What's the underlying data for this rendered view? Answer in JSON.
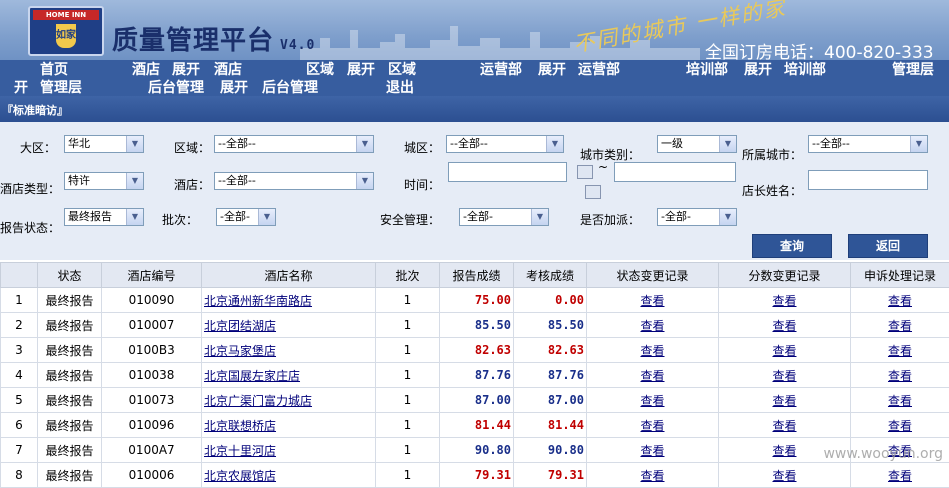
{
  "header": {
    "logo_brand": "HOME INN",
    "logo_glyph": "如家",
    "title": "质量管理平台",
    "version": "V4.0",
    "slogan": "不同的城市 一样的家",
    "phone": "全国订房电话：400-820-333"
  },
  "nav": {
    "row1": [
      "首页",
      "酒店",
      "展开",
      "酒店",
      "区域",
      "展开",
      "区域",
      "运营部",
      "展开",
      "运营部",
      "培训部",
      "展开",
      "培训部",
      "管理层"
    ],
    "row2": [
      "开",
      "管理层",
      "后台管理",
      "展开",
      "后台管理",
      "退出"
    ]
  },
  "subbar": {
    "label": "『标准暗访』"
  },
  "filters": {
    "region_label": "大区：",
    "region_value": "华北",
    "area_label": "区域：",
    "area_value": "--全部--",
    "district_label": "城区：",
    "district_value": "--全部--",
    "city_type_label": "城市类别：",
    "city_type_value": "一级",
    "city_label": "所属城市：",
    "city_value": "--全部--",
    "hotel_type_label": "酒店类型：",
    "hotel_type_value": "特许",
    "hotel_label": "酒店：",
    "hotel_value": "--全部--",
    "time_label": "时间：",
    "time_sep": "~",
    "manager_label": "店长姓名：",
    "report_status_label": "报告状态：",
    "report_status_value": "最终报告",
    "batch_label": "批次：",
    "batch_value": "-全部-",
    "safety_label": "安全管理：",
    "safety_value": "-全部-",
    "dispatch_label": "是否加派：",
    "dispatch_value": "-全部-",
    "query_button": "查询",
    "back_button": "返回"
  },
  "table": {
    "headers": [
      "",
      "状态",
      "酒店编号",
      "酒店名称",
      "批次",
      "报告成绩",
      "考核成绩",
      "状态变更记录",
      "分数变更记录",
      "申诉处理记录"
    ],
    "rows": [
      {
        "no": "1",
        "status": "最终报告",
        "code": "010090",
        "name": "北京通州新华南路店",
        "batch": "1",
        "report": "75.00",
        "assess": "0.00",
        "c1": "查看",
        "c2": "查看",
        "c3": "查看",
        "report_color": "#c00000",
        "assess_color": "#c00000"
      },
      {
        "no": "2",
        "status": "最终报告",
        "code": "010007",
        "name": "北京团结湖店",
        "batch": "1",
        "report": "85.50",
        "assess": "85.50",
        "c1": "查看",
        "c2": "查看",
        "c3": "查看",
        "report_color": "#1a2f8a",
        "assess_color": "#1a2f8a"
      },
      {
        "no": "3",
        "status": "最终报告",
        "code": "0100B3",
        "name": "北京马家堡店",
        "batch": "1",
        "report": "82.63",
        "assess": "82.63",
        "c1": "查看",
        "c2": "查看",
        "c3": "查看",
        "report_color": "#c00000",
        "assess_color": "#c00000"
      },
      {
        "no": "4",
        "status": "最终报告",
        "code": "010038",
        "name": "北京国展左家庄店",
        "batch": "1",
        "report": "87.76",
        "assess": "87.76",
        "c1": "查看",
        "c2": "查看",
        "c3": "查看",
        "report_color": "#1a2f8a",
        "assess_color": "#1a2f8a"
      },
      {
        "no": "5",
        "status": "最终报告",
        "code": "010073",
        "name": "北京广渠门富力城店",
        "batch": "1",
        "report": "87.00",
        "assess": "87.00",
        "c1": "查看",
        "c2": "查看",
        "c3": "查看",
        "report_color": "#1a2f8a",
        "assess_color": "#1a2f8a"
      },
      {
        "no": "6",
        "status": "最终报告",
        "code": "010096",
        "name": "北京联想桥店",
        "batch": "1",
        "report": "81.44",
        "assess": "81.44",
        "c1": "查看",
        "c2": "查看",
        "c3": "查看",
        "report_color": "#c00000",
        "assess_color": "#c00000"
      },
      {
        "no": "7",
        "status": "最终报告",
        "code": "0100A7",
        "name": "北京十里河店",
        "batch": "1",
        "report": "90.80",
        "assess": "90.80",
        "c1": "查看",
        "c2": "查看",
        "c3": "查看",
        "report_color": "#1a2f8a",
        "assess_color": "#1a2f8a"
      },
      {
        "no": "8",
        "status": "最终报告",
        "code": "010006",
        "name": "北京农展馆店",
        "batch": "1",
        "report": "79.31",
        "assess": "79.31",
        "c1": "查看",
        "c2": "查看",
        "c3": "查看",
        "report_color": "#c00000",
        "assess_color": "#c00000"
      }
    ]
  },
  "watermark": "www.wooyun.org"
}
